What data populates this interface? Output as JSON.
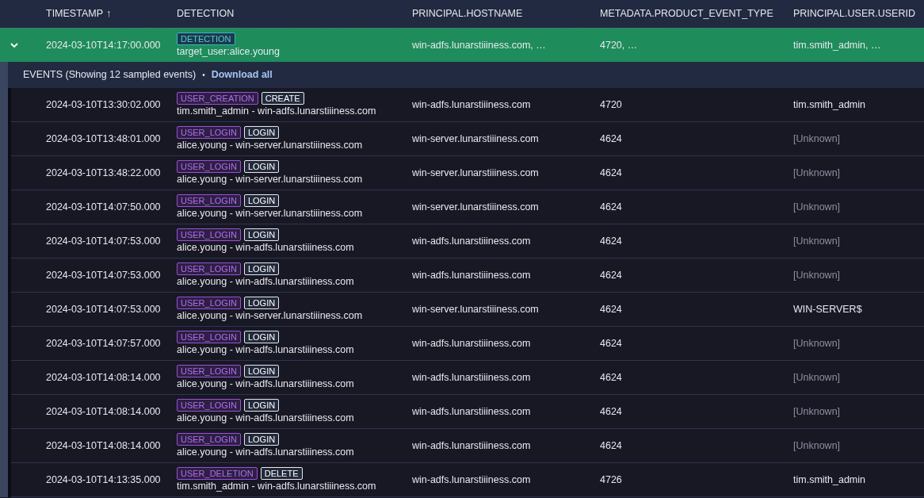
{
  "columns": [
    {
      "label": "TIMESTAMP",
      "sort": "↑"
    },
    {
      "label": "DETECTION"
    },
    {
      "label": "PRINCIPAL.HOSTNAME"
    },
    {
      "label": "METADATA.PRODUCT_EVENT_TYPE"
    },
    {
      "label": "PRINCIPAL.USER.USERID"
    }
  ],
  "detection": {
    "expanded": true,
    "timestamp": "2024-03-10T14:17:00.000",
    "tag": "DETECTION",
    "summary": "target_user:alice.young",
    "hostname": "win-adfs.lunarstiiiness.com, …",
    "event_type": "4720, …",
    "userid": "tim.smith_admin, …"
  },
  "events_bar": {
    "text": "EVENTS (Showing 12 sampled events)",
    "separator": "•",
    "link": "Download all"
  },
  "events": [
    {
      "timestamp": "2024-03-10T13:30:02.000",
      "type": "USER_CREATION",
      "action": "CREATE",
      "summary": "tim.smith_admin - win-adfs.lunarstiiiness.com",
      "hostname": "win-adfs.lunarstiiiness.com",
      "event_type": "4720",
      "userid": "tim.smith_admin",
      "unknown": false
    },
    {
      "timestamp": "2024-03-10T13:48:01.000",
      "type": "USER_LOGIN",
      "action": "LOGIN",
      "summary": "alice.young - win-server.lunarstiiiness.com",
      "hostname": "win-server.lunarstiiiness.com",
      "event_type": "4624",
      "userid": "[Unknown]",
      "unknown": true
    },
    {
      "timestamp": "2024-03-10T13:48:22.000",
      "type": "USER_LOGIN",
      "action": "LOGIN",
      "summary": "alice.young - win-server.lunarstiiiness.com",
      "hostname": "win-server.lunarstiiiness.com",
      "event_type": "4624",
      "userid": "[Unknown]",
      "unknown": true
    },
    {
      "timestamp": "2024-03-10T14:07:50.000",
      "type": "USER_LOGIN",
      "action": "LOGIN",
      "summary": "alice.young - win-server.lunarstiiiness.com",
      "hostname": "win-server.lunarstiiiness.com",
      "event_type": "4624",
      "userid": "[Unknown]",
      "unknown": true
    },
    {
      "timestamp": "2024-03-10T14:07:53.000",
      "type": "USER_LOGIN",
      "action": "LOGIN",
      "summary": "alice.young - win-adfs.lunarstiiiness.com",
      "hostname": "win-adfs.lunarstiiiness.com",
      "event_type": "4624",
      "userid": "[Unknown]",
      "unknown": true
    },
    {
      "timestamp": "2024-03-10T14:07:53.000",
      "type": "USER_LOGIN",
      "action": "LOGIN",
      "summary": "alice.young - win-adfs.lunarstiiiness.com",
      "hostname": "win-adfs.lunarstiiiness.com",
      "event_type": "4624",
      "userid": "[Unknown]",
      "unknown": true
    },
    {
      "timestamp": "2024-03-10T14:07:53.000",
      "type": "USER_LOGIN",
      "action": "LOGIN",
      "summary": "alice.young - win-server.lunarstiiiness.com",
      "hostname": "win-server.lunarstiiiness.com",
      "event_type": "4624",
      "userid": "WIN-SERVER$",
      "unknown": false
    },
    {
      "timestamp": "2024-03-10T14:07:57.000",
      "type": "USER_LOGIN",
      "action": "LOGIN",
      "summary": "alice.young - win-adfs.lunarstiiiness.com",
      "hostname": "win-adfs.lunarstiiiness.com",
      "event_type": "4624",
      "userid": "[Unknown]",
      "unknown": true
    },
    {
      "timestamp": "2024-03-10T14:08:14.000",
      "type": "USER_LOGIN",
      "action": "LOGIN",
      "summary": "alice.young - win-adfs.lunarstiiiness.com",
      "hostname": "win-adfs.lunarstiiiness.com",
      "event_type": "4624",
      "userid": "[Unknown]",
      "unknown": true
    },
    {
      "timestamp": "2024-03-10T14:08:14.000",
      "type": "USER_LOGIN",
      "action": "LOGIN",
      "summary": "alice.young - win-adfs.lunarstiiiness.com",
      "hostname": "win-adfs.lunarstiiiness.com",
      "event_type": "4624",
      "userid": "[Unknown]",
      "unknown": true
    },
    {
      "timestamp": "2024-03-10T14:08:14.000",
      "type": "USER_LOGIN",
      "action": "LOGIN",
      "summary": "alice.young - win-adfs.lunarstiiiness.com",
      "hostname": "win-adfs.lunarstiiiness.com",
      "event_type": "4624",
      "userid": "[Unknown]",
      "unknown": true
    },
    {
      "timestamp": "2024-03-10T14:13:35.000",
      "type": "USER_DELETION",
      "action": "DELETE",
      "summary": "tim.smith_admin - win-adfs.lunarstiiiness.com",
      "hostname": "win-adfs.lunarstiiiness.com",
      "event_type": "4726",
      "userid": "tim.smith_admin",
      "unknown": false
    }
  ]
}
